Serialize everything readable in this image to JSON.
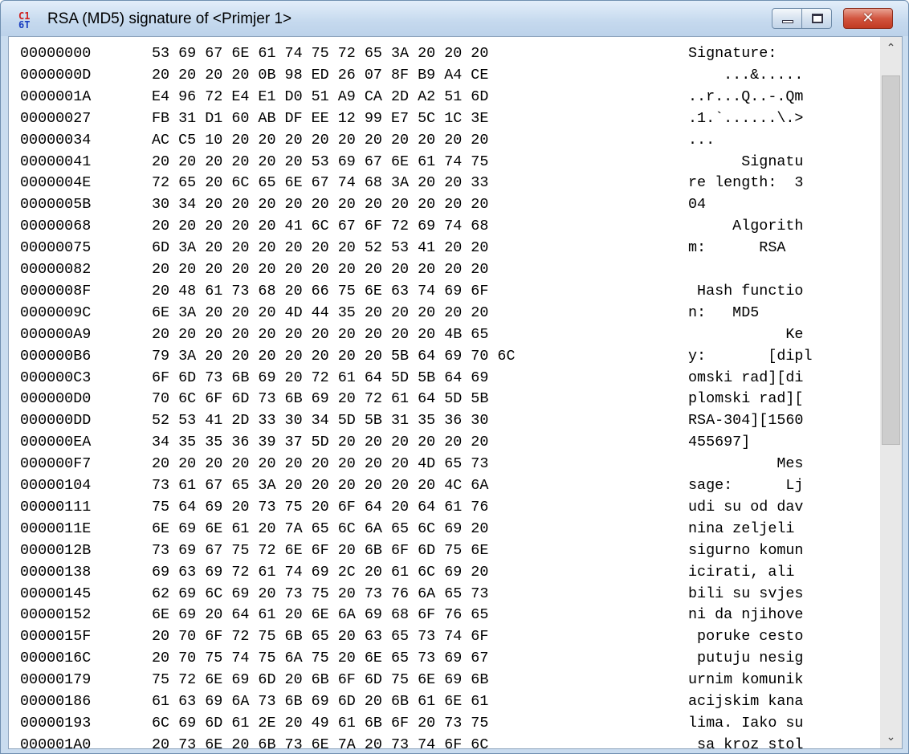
{
  "window": {
    "title": "RSA (MD5) signature of <Primjer 1>",
    "icon_name": "hex-editor-icon",
    "icon_glyphs": [
      "C1",
      "6T"
    ]
  },
  "controls": {
    "minimize_icon": "minimize-icon",
    "maximize_icon": "maximize-icon",
    "close_icon": "close-icon",
    "close_glyph": "✕"
  },
  "scrollbar": {
    "up_glyph": "⌃",
    "down_glyph": "⌄",
    "thumb_position_fraction": 0.0
  },
  "rows": [
    {
      "addr": "00000000",
      "hex": "53 69 67 6E 61 74 75 72 65 3A 20 20 20",
      "ascii": "Signature:   "
    },
    {
      "addr": "0000000D",
      "hex": "20 20 20 20 0B 98 ED 26 07 8F B9 A4 CE",
      "ascii": "    ...&.....  "
    },
    {
      "addr": "0000001A",
      "hex": "E4 96 72 E4 E1 D0 51 A9 CA 2D A2 51 6D",
      "ascii": "..r...Q..-.Qm"
    },
    {
      "addr": "00000027",
      "hex": "FB 31 D1 60 AB DF EE 12 99 E7 5C 1C 3E",
      "ascii": ".1.`......\\.>"
    },
    {
      "addr": "00000034",
      "hex": "AC C5 10 20 20 20 20 20 20 20 20 20 20",
      "ascii": "...          "
    },
    {
      "addr": "00000041",
      "hex": "20 20 20 20 20 20 53 69 67 6E 61 74 75",
      "ascii": "      Signatu"
    },
    {
      "addr": "0000004E",
      "hex": "72 65 20 6C 65 6E 67 74 68 3A 20 20 33",
      "ascii": "re length:  3"
    },
    {
      "addr": "0000005B",
      "hex": "30 34 20 20 20 20 20 20 20 20 20 20 20",
      "ascii": "04           "
    },
    {
      "addr": "00000068",
      "hex": "20 20 20 20 20 41 6C 67 6F 72 69 74 68",
      "ascii": "     Algorith"
    },
    {
      "addr": "00000075",
      "hex": "6D 3A 20 20 20 20 20 20 52 53 41 20 20",
      "ascii": "m:      RSA  "
    },
    {
      "addr": "00000082",
      "hex": "20 20 20 20 20 20 20 20 20 20 20 20 20",
      "ascii": "             "
    },
    {
      "addr": "0000008F",
      "hex": "20 48 61 73 68 20 66 75 6E 63 74 69 6F",
      "ascii": " Hash functio"
    },
    {
      "addr": "0000009C",
      "hex": "6E 3A 20 20 20 4D 44 35 20 20 20 20 20",
      "ascii": "n:   MD5     "
    },
    {
      "addr": "000000A9",
      "hex": "20 20 20 20 20 20 20 20 20 20 20 4B 65",
      "ascii": "           Ke"
    },
    {
      "addr": "000000B6",
      "hex": "79 3A 20 20 20 20 20 20 20 5B 64 69 70 6C",
      "ascii": "y:       [dipl"
    },
    {
      "addr": "000000C3",
      "hex": "6F 6D 73 6B 69 20 72 61 64 5D 5B 64 69",
      "ascii": "omski rad][di"
    },
    {
      "addr": "000000D0",
      "hex": "70 6C 6F 6D 73 6B 69 20 72 61 64 5D 5B",
      "ascii": "plomski rad]["
    },
    {
      "addr": "000000DD",
      "hex": "52 53 41 2D 33 30 34 5D 5B 31 35 36 30",
      "ascii": "RSA-304][1560"
    },
    {
      "addr": "000000EA",
      "hex": "34 35 35 36 39 37 5D 20 20 20 20 20 20",
      "ascii": "455697]      "
    },
    {
      "addr": "000000F7",
      "hex": "20 20 20 20 20 20 20 20 20 20 4D 65 73",
      "ascii": "          Mes"
    },
    {
      "addr": "00000104",
      "hex": "73 61 67 65 3A 20 20 20 20 20 20 4C 6A",
      "ascii": "sage:      Lj"
    },
    {
      "addr": "00000111",
      "hex": "75 64 69 20 73 75 20 6F 64 20 64 61 76",
      "ascii": "udi su od dav"
    },
    {
      "addr": "0000011E",
      "hex": "6E 69 6E 61 20 7A 65 6C 6A 65 6C 69 20",
      "ascii": "nina zeljeli "
    },
    {
      "addr": "0000012B",
      "hex": "73 69 67 75 72 6E 6F 20 6B 6F 6D 75 6E",
      "ascii": "sigurno komun"
    },
    {
      "addr": "00000138",
      "hex": "69 63 69 72 61 74 69 2C 20 61 6C 69 20",
      "ascii": "icirati, ali "
    },
    {
      "addr": "00000145",
      "hex": "62 69 6C 69 20 73 75 20 73 76 6A 65 73",
      "ascii": "bili su svjes"
    },
    {
      "addr": "00000152",
      "hex": "6E 69 20 64 61 20 6E 6A 69 68 6F 76 65",
      "ascii": "ni da njihove"
    },
    {
      "addr": "0000015F",
      "hex": "20 70 6F 72 75 6B 65 20 63 65 73 74 6F",
      "ascii": " poruke cesto"
    },
    {
      "addr": "0000016C",
      "hex": "20 70 75 74 75 6A 75 20 6E 65 73 69 67",
      "ascii": " putuju nesig"
    },
    {
      "addr": "00000179",
      "hex": "75 72 6E 69 6D 20 6B 6F 6D 75 6E 69 6B",
      "ascii": "urnim komunik"
    },
    {
      "addr": "00000186",
      "hex": "61 63 69 6A 73 6B 69 6D 20 6B 61 6E 61",
      "ascii": "acijskim kana"
    },
    {
      "addr": "00000193",
      "hex": "6C 69 6D 61 2E 20 49 61 6B 6F 20 73 75",
      "ascii": "lima. Iako su"
    },
    {
      "addr": "000001A0",
      "hex": "20 73 6E 20 6B 73 6E 7A 20 73 74 6F 6C",
      "ascii": " sa kroz stol"
    }
  ]
}
